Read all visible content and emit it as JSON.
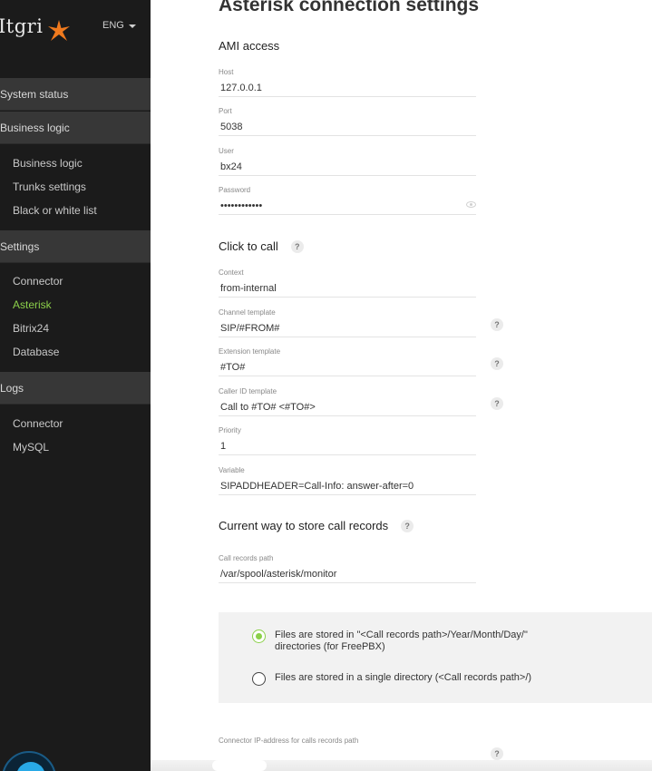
{
  "sidebar": {
    "logo_text": "Itgri",
    "lang": "ENG",
    "sections": [
      {
        "label": "System status"
      },
      {
        "label": "Business logic",
        "items": [
          "Business logic",
          "Trunks settings",
          "Black or white list"
        ]
      },
      {
        "label": "Settings",
        "items": [
          "Connector",
          "Asterisk",
          "Bitrix24",
          "Database"
        ]
      },
      {
        "label": "Logs",
        "items": [
          "Connector",
          "MySQL"
        ]
      }
    ],
    "active_item": "Asterisk",
    "accent_color": "#8bd04a"
  },
  "main": {
    "title": "Asterisk connection settings",
    "ami": {
      "title": "AMI access",
      "host": {
        "label": "Host",
        "value": "127.0.0.1"
      },
      "port": {
        "label": "Port",
        "value": "5038"
      },
      "user": {
        "label": "User",
        "value": "bx24"
      },
      "password": {
        "label": "Password",
        "value": "••••••••••••"
      }
    },
    "click_to_call": {
      "title": "Click to call",
      "help": "?",
      "context": {
        "label": "Context",
        "value": "from-internal"
      },
      "channel": {
        "label": "Channel template",
        "value": "SIP/#FROM#"
      },
      "extension": {
        "label": "Extension template",
        "value": "#TO#"
      },
      "callerid": {
        "label": "Caller ID template",
        "value": "Call to #TO# <#TO#>"
      },
      "priority": {
        "label": "Priority",
        "value": "1"
      },
      "variable": {
        "label": "Variable",
        "value": "SIPADDHEADER=Call-Info: answer-after=0"
      }
    },
    "records": {
      "title": "Current way to store call records",
      "help": "?",
      "path": {
        "label": "Call records path",
        "value": "/var/spool/asterisk/monitor"
      },
      "option1_line1": "Files are stored in \"<Call records path>/Year/Month/Day/\"",
      "option1_line2": "directories (for FreePBX)",
      "option2": "Files are stored in a single directory (<Call records path>/)",
      "connector_ip_label": "Connector IP-address for calls records path"
    }
  }
}
